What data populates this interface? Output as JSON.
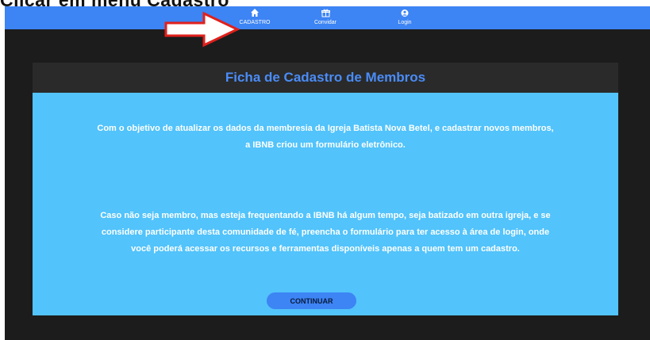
{
  "caption": "Clicar em menu Cadastro",
  "nav": {
    "items": [
      {
        "label": "CADASTRO",
        "icon": "home-icon"
      },
      {
        "label": "Convidar",
        "icon": "gift-icon"
      },
      {
        "label": "Login",
        "icon": "user-icon"
      }
    ]
  },
  "panel": {
    "title": "Ficha de Cadastro de Membros",
    "paragraph_1_line_1": "Com o objetivo de atualizar os dados da membresia da Igreja Batista Nova Betel, e cadastrar novos membros,",
    "paragraph_1_line_2": "a IBNB criou um formulário eletrônico.",
    "paragraph_2_line_1": "Caso não seja membro, mas esteja frequentando a IBNB há algum tempo, seja batizado em outra igreja, e se",
    "paragraph_2_line_2": "considere participante desta comunidade de fé, preencha o formulário para ter acesso à área de login, onde",
    "paragraph_2_line_3": "você poderá acessar os recursos e ferramentas disponíveis apenas a quem tem um cadastro.",
    "button_label": "CONTINUAR"
  },
  "colors": {
    "navbar": "#3d84f4",
    "background": "#1c1c1c",
    "panel_header": "#2a2a2a",
    "panel_title": "#4a8cf6",
    "panel_body": "#52c3fb",
    "arrow_fill": "#ffffff",
    "arrow_stroke": "#e0201c"
  }
}
